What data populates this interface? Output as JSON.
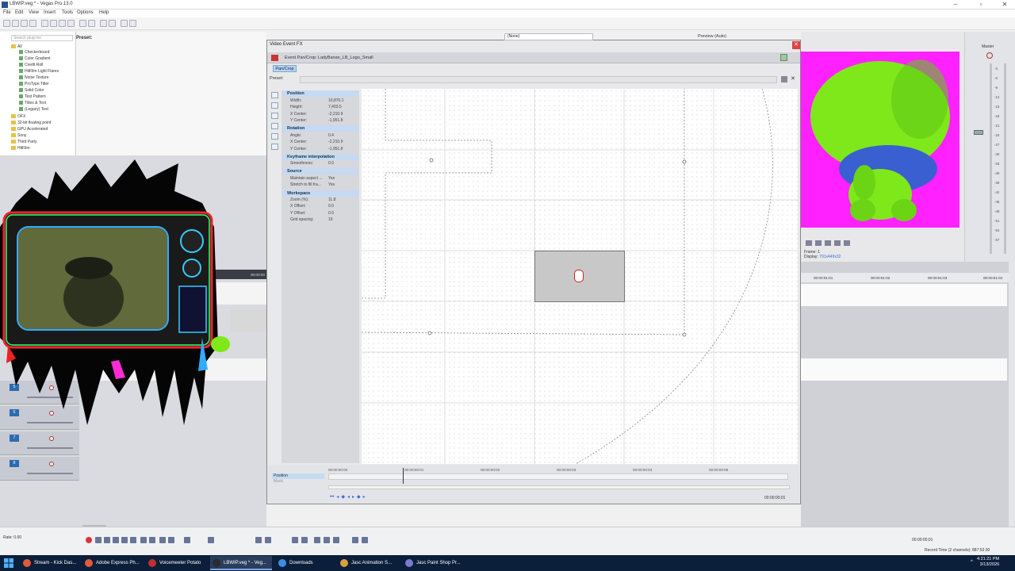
{
  "window": {
    "title": "LBWIP.veg * - Vegas Pro 13.0"
  },
  "menu": [
    "File",
    "Edit",
    "View",
    "Insert",
    "Tools",
    "Options",
    "Help"
  ],
  "explorer": {
    "search_placeholder": "Search plug-ins",
    "preset_label": "Preset:",
    "items": [
      "All",
      "Checkerboard",
      "Color Gradient",
      "Credit Roll",
      "HitFilm Light Flares",
      "Noise Texture",
      "ProType Titler",
      "Solid Color",
      "Test Pattern",
      "Titles & Text",
      "(Legacy) Text",
      "OFX",
      "32-bit floating point",
      "GPU Accelerated",
      "Sony",
      "Third Party",
      "HitFilm"
    ]
  },
  "dialog": {
    "title": "Video Event FX",
    "chain_label": "Event Pan/Crop:  LadyBanan_LB_Logo_Small",
    "tab": "Pan/Crop",
    "preset_label": "Preset:",
    "sections": {
      "position": {
        "title": "Position",
        "rows": [
          {
            "label": "Width:",
            "value": "10,870.1"
          },
          {
            "label": "Height:",
            "value": "7,403.5"
          },
          {
            "label": "X Center:",
            "value": "-2,210.9"
          },
          {
            "label": "Y Center:",
            "value": "-1,951.8"
          }
        ]
      },
      "rotation": {
        "title": "Rotation",
        "rows": [
          {
            "label": "Angle:",
            "value": "0.4"
          },
          {
            "label": "X Center:",
            "value": "-2,210.9"
          },
          {
            "label": "Y Center:",
            "value": "-1,951.8"
          }
        ]
      },
      "keyframe": {
        "title": "Keyframe interpolation",
        "rows": [
          {
            "label": "Smoothness:",
            "value": "0.0"
          }
        ]
      },
      "source": {
        "title": "Source",
        "rows": [
          {
            "label": "Maintain aspect ...",
            "value": "Yes"
          },
          {
            "label": "Stretch to fill fra...",
            "value": "Yes"
          }
        ]
      },
      "workspace": {
        "title": "Workspace",
        "rows": [
          {
            "label": "Zoom (%):",
            "value": "11.8"
          },
          {
            "label": "X Offset:",
            "value": "0.0"
          },
          {
            "label": "Y Offset:",
            "value": "0.0"
          },
          {
            "label": "Grid spacing:",
            "value": "16"
          }
        ]
      }
    },
    "keyframes": {
      "list": [
        "Position",
        "Mask"
      ],
      "ticks": [
        "00:00:00:00",
        "00:00:00:01",
        "00:00:00:02",
        "00:00:00:03",
        "00:00:00:04",
        "00:00:00:05"
      ],
      "current_time": "00:00:00;01"
    }
  },
  "preview": {
    "mode": "Preview (Auto)",
    "none_label": "(None)",
    "frame_label": "Frame:",
    "frame_value": "1",
    "display_label": "Display:",
    "display_value": "791x449x32"
  },
  "master": {
    "label": "Master",
    "meter_ticks": [
      "3",
      "6",
      "9",
      "12",
      "15",
      "18",
      "21",
      "24",
      "27",
      "30",
      "33",
      "36",
      "39",
      "42",
      "45",
      "48",
      "51",
      "54",
      "57"
    ]
  },
  "timeline": {
    "ruler_ticks": [
      "00:00:01:01",
      "00:00:01:02",
      "00:00:01:03",
      "00:00:01:04"
    ],
    "left_tick": "00:00:00",
    "track_numbers": [
      "5",
      "6",
      "7",
      "8"
    ]
  },
  "transport": {
    "rate": "Rate: 0.00",
    "time": "00:00:00;01",
    "record_time": "Record Time (2 channels): 887:53:30"
  },
  "taskbar": {
    "items": [
      {
        "label": "Stream - Kick Das...",
        "color": "#e35a3a"
      },
      {
        "label": "Adobe Express Ph...",
        "color": "#e35a3a"
      },
      {
        "label": "Voicemeeter Potato",
        "color": "#c03030"
      },
      {
        "label": "LBWIP.veg * - Veg...",
        "color": "#2b2b2b"
      },
      {
        "label": "Downloads",
        "color": "#3b8ee6"
      },
      {
        "label": "Jasc Animation S...",
        "color": "#d8a040"
      },
      {
        "label": "Jasc Paint Shop Pr...",
        "color": "#7a7ad0"
      }
    ],
    "time": "4:21:21 PM",
    "date": "3/13/2026"
  },
  "colors": {
    "accent": "#3b6ed0",
    "preview_bg": "#ff21ff",
    "frog": "#7fe81a"
  }
}
